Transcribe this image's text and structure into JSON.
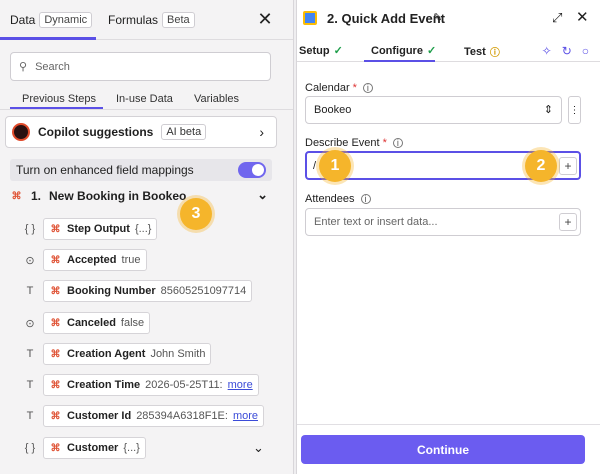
{
  "left_panel": {
    "top_tabs": {
      "data_label": "Data",
      "data_badge": "Dynamic",
      "formulas_label": "Formulas",
      "formulas_badge": "Beta"
    },
    "search": {
      "placeholder": "Search"
    },
    "sub_tabs": [
      "Previous Steps",
      "In-use Data",
      "Variables"
    ],
    "copilot": {
      "label": "Copilot suggestions",
      "badge": "AI beta"
    },
    "toggle": {
      "label": "Turn on enhanced field mappings",
      "on": true
    },
    "step": {
      "number": "1.",
      "title": "New Booking in Bookeo"
    },
    "fields": [
      {
        "type": "{ }",
        "name": "Step Output",
        "value": "{...}",
        "more": ""
      },
      {
        "type": "toggle",
        "name": "Accepted",
        "value": "true",
        "more": ""
      },
      {
        "type": "T",
        "name": "Booking Number",
        "value": "85605251097714",
        "more": ""
      },
      {
        "type": "toggle",
        "name": "Canceled",
        "value": "false",
        "more": ""
      },
      {
        "type": "T",
        "name": "Creation Agent",
        "value": "John Smith",
        "more": ""
      },
      {
        "type": "T",
        "name": "Creation Time",
        "value": "2026-05-25T11:",
        "more": "more"
      },
      {
        "type": "T",
        "name": "Customer Id",
        "value": "285394A6318F1E:",
        "more": "more"
      },
      {
        "type": "{ }",
        "name": "Customer",
        "value": "{...}",
        "more": ""
      }
    ]
  },
  "right_panel": {
    "title": "2. Quick Add Event",
    "tabs": {
      "setup": "Setup",
      "configure": "Configure",
      "test": "Test"
    },
    "calendar": {
      "label": "Calendar",
      "value": "Bookeo"
    },
    "describe_event": {
      "label": "Describe Event",
      "value": "/"
    },
    "attendees": {
      "label": "Attendees",
      "placeholder": "Enter text or insert data..."
    },
    "continue_label": "Continue"
  },
  "badges": [
    "1",
    "2",
    "3"
  ],
  "colors": {
    "accent": "#5b50e6",
    "badge": "#f5b52b",
    "bookeo": "#e0573a"
  }
}
